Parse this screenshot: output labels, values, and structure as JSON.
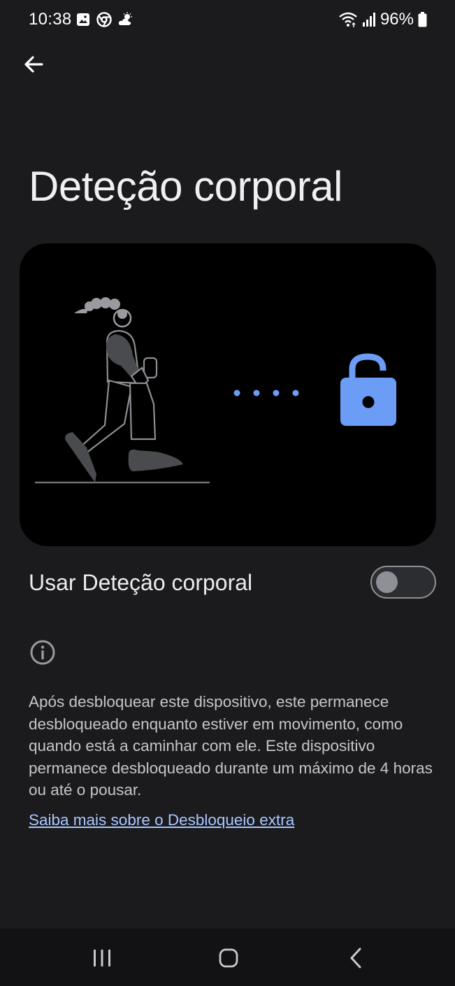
{
  "status_bar": {
    "time": "10:38",
    "battery": "96%",
    "icons": [
      "gallery-icon",
      "chrome-icon",
      "weather-icon",
      "wifi-icon",
      "signal-icon",
      "battery-icon"
    ]
  },
  "header": {
    "back_icon": "arrow-left-icon",
    "title": "Deteção corporal"
  },
  "illustration": {
    "lock_color": "#6b9cf6",
    "dots_color": "#6b9cf6"
  },
  "toggle": {
    "label": "Usar Deteção corporal",
    "enabled": false
  },
  "info": {
    "icon": "info-icon",
    "description": "Após desbloquear este dispositivo, este permanece desbloqueado enquanto estiver em movimento, como quando está a caminhar com ele. Este dispositivo permanece desbloqueado durante um máximo de 4 horas ou até o pousar.",
    "link": "Saiba mais sobre o Desbloqueio extra"
  },
  "nav_bar": {
    "buttons": [
      "recents-icon",
      "home-icon",
      "back-icon"
    ]
  },
  "colors": {
    "background": "#1b1b1d",
    "link": "#a9c7ff",
    "accent": "#6b9cf6"
  }
}
